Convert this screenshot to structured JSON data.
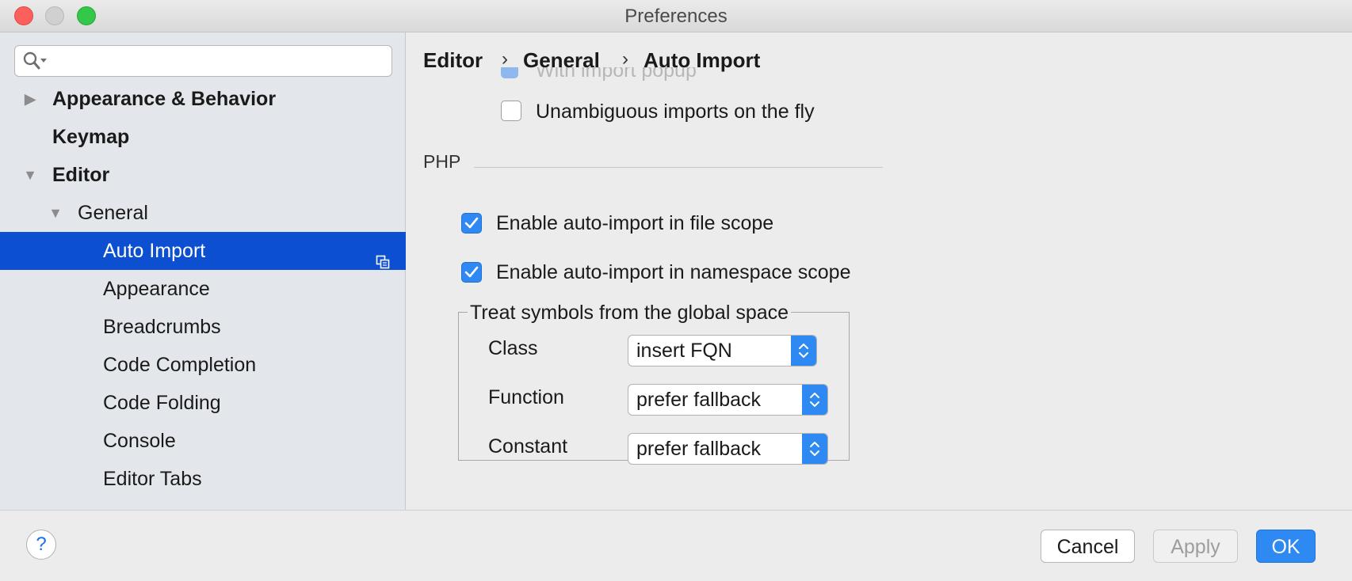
{
  "window": {
    "title": "Preferences"
  },
  "search": {
    "value": "",
    "placeholder": ""
  },
  "sidebar": {
    "items": [
      {
        "label": "Appearance & Behavior"
      },
      {
        "label": "Keymap"
      },
      {
        "label": "Editor"
      },
      {
        "label": "General"
      },
      {
        "label": "Auto Import"
      },
      {
        "label": "Appearance"
      },
      {
        "label": "Breadcrumbs"
      },
      {
        "label": "Code Completion"
      },
      {
        "label": "Code Folding"
      },
      {
        "label": "Console"
      },
      {
        "label": "Editor Tabs"
      }
    ]
  },
  "breadcrumb": [
    "Editor",
    "General",
    "Auto Import"
  ],
  "content": {
    "partial_label": "With import popup",
    "unambiguous_label": "Unambiguous imports on the fly",
    "unambiguous_checked": false,
    "php_section": "PHP",
    "file_scope_label": "Enable auto-import in file scope",
    "file_scope_checked": true,
    "namespace_scope_label": "Enable auto-import in namespace scope",
    "namespace_scope_checked": true,
    "global_group_title": "Treat symbols from the global space",
    "rows": [
      {
        "label": "Class",
        "value": "insert FQN"
      },
      {
        "label": "Function",
        "value": "prefer fallback"
      },
      {
        "label": "Constant",
        "value": "prefer fallback"
      }
    ]
  },
  "buttons": {
    "help": "?",
    "cancel": "Cancel",
    "apply": "Apply",
    "ok": "OK"
  },
  "colors": {
    "accent": "#2e89f2",
    "selection": "#0c4fd1"
  }
}
